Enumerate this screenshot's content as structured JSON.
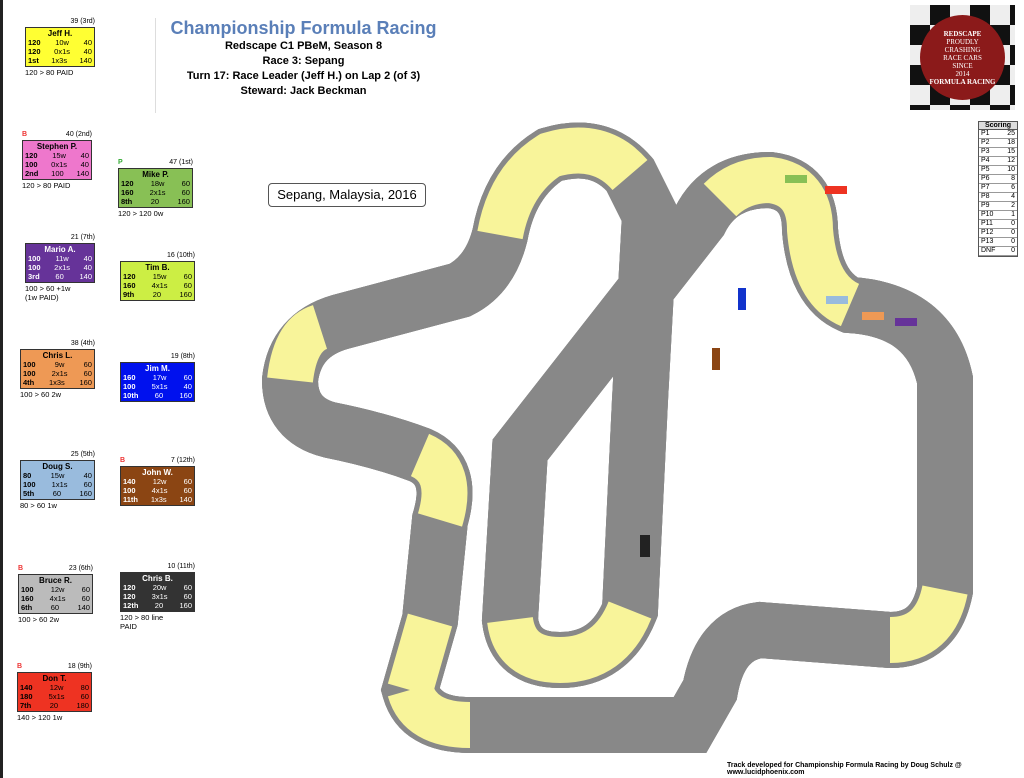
{
  "header": {
    "title": "Championship Formula Racing",
    "lines": [
      "Redscape C1 PBeM, Season 8",
      "Race 3: Sepang",
      "Turn 17: Race Leader (Jeff H.) on Lap 2 (of 3)",
      "Steward: Jack Beckman"
    ]
  },
  "location": "Sepang, Malaysia, 2016",
  "logo": {
    "text": "REDSCAPE FORMULA RACING PROUDLY CRASHING RACE CARS SINCE 2014"
  },
  "credit": "Track developed for Championship Formula Racing by Doug Schulz @ www.lucidphoenix.com",
  "scoring": {
    "title": "Scoring",
    "rows": [
      [
        "P1",
        "25"
      ],
      [
        "P2",
        "18"
      ],
      [
        "P3",
        "15"
      ],
      [
        "P4",
        "12"
      ],
      [
        "P5",
        "10"
      ],
      [
        "P6",
        "8"
      ],
      [
        "P7",
        "6"
      ],
      [
        "P8",
        "4"
      ],
      [
        "P9",
        "2"
      ],
      [
        "P10",
        "1"
      ],
      [
        "P11",
        "0"
      ],
      [
        "P12",
        "0"
      ],
      [
        "P13",
        "0"
      ],
      [
        "DNF",
        "0"
      ]
    ]
  },
  "drivers": [
    {
      "name": "Jeff H.",
      "pts": "39 (3rd)",
      "flag": "",
      "color": "#ffff33",
      "fg": "#000",
      "rows": [
        [
          "120",
          "10w",
          "40"
        ],
        [
          "120",
          "0x1s",
          "40"
        ],
        [
          "1st",
          "1x3s",
          "140"
        ]
      ],
      "note": "120 > 80 PAID"
    },
    {
      "name": "Stephen P.",
      "pts": "40 (2nd)",
      "flag": "B",
      "color": "#ee77cc",
      "fg": "#000",
      "rows": [
        [
          "120",
          "15w",
          "40"
        ],
        [
          "100",
          "0x1s",
          "40"
        ],
        [
          "2nd",
          "100",
          "140"
        ]
      ],
      "note": "120 > 80 PAID"
    },
    {
      "name": "Mike P.",
      "pts": "47 (1st)",
      "flag": "P",
      "color": "#88c055",
      "fg": "#000",
      "rows": [
        [
          "120",
          "18w",
          "60"
        ],
        [
          "160",
          "2x1s",
          "60"
        ],
        [
          "8th",
          "20",
          "160"
        ]
      ],
      "note": "120 > 120 0w"
    },
    {
      "name": "Mario A.",
      "pts": "21 (7th)",
      "flag": "",
      "color": "#663399",
      "fg": "#fff",
      "rows": [
        [
          "100",
          "11w",
          "40"
        ],
        [
          "100",
          "2x1s",
          "40"
        ],
        [
          "3rd",
          "60",
          "140"
        ]
      ],
      "note": "100 > 60 +1w\n(1w PAID)"
    },
    {
      "name": "Tim B.",
      "pts": "16 (10th)",
      "flag": "",
      "color": "#ccee44",
      "fg": "#000",
      "rows": [
        [
          "120",
          "15w",
          "60"
        ],
        [
          "160",
          "4x1s",
          "60"
        ],
        [
          "9th",
          "20",
          "160"
        ]
      ],
      "note": ""
    },
    {
      "name": "Chris L.",
      "pts": "38 (4th)",
      "flag": "",
      "color": "#ee9955",
      "fg": "#000",
      "rows": [
        [
          "100",
          "9w",
          "60"
        ],
        [
          "100",
          "2x1s",
          "60"
        ],
        [
          "4th",
          "1x3s",
          "160"
        ]
      ],
      "note": "100 > 60 2w"
    },
    {
      "name": "Jim M.",
      "pts": "19 (8th)",
      "flag": "",
      "color": "#0011ee",
      "fg": "#fff",
      "rows": [
        [
          "160",
          "17w",
          "60"
        ],
        [
          "100",
          "5x1s",
          "40"
        ],
        [
          "10th",
          "60",
          "160"
        ]
      ],
      "note": ""
    },
    {
      "name": "Doug S.",
      "pts": "25 (5th)",
      "flag": "",
      "color": "#99bbdd",
      "fg": "#000",
      "rows": [
        [
          "80",
          "15w",
          "40"
        ],
        [
          "100",
          "1x1s",
          "60"
        ],
        [
          "5th",
          "60",
          "160"
        ]
      ],
      "note": "80 > 60 1w"
    },
    {
      "name": "John W.",
      "pts": "7 (12th)",
      "flag": "B",
      "color": "#8b4513",
      "fg": "#fff",
      "rows": [
        [
          "140",
          "12w",
          "60"
        ],
        [
          "100",
          "4x1s",
          "60"
        ],
        [
          "11th",
          "1x3s",
          "140"
        ]
      ],
      "note": ""
    },
    {
      "name": "Bruce R.",
      "pts": "23 (6th)",
      "flag": "B",
      "color": "#bbbbbb",
      "fg": "#000",
      "rows": [
        [
          "100",
          "12w",
          "60"
        ],
        [
          "160",
          "4x1s",
          "60"
        ],
        [
          "6th",
          "60",
          "140"
        ]
      ],
      "note": "100 > 60 2w"
    },
    {
      "name": "Chris B.",
      "pts": "10 (11th)",
      "flag": "",
      "color": "#333333",
      "fg": "#fff",
      "rows": [
        [
          "120",
          "20w",
          "60"
        ],
        [
          "120",
          "3x1s",
          "60"
        ],
        [
          "12th",
          "20",
          "160"
        ]
      ],
      "note": "120 > 80 line\nPAID"
    },
    {
      "name": "Don T.",
      "pts": "18 (9th)",
      "flag": "B",
      "color": "#ee3322",
      "fg": "#000",
      "rows": [
        [
          "140",
          "12w",
          "80"
        ],
        [
          "180",
          "5x1s",
          "60"
        ],
        [
          "7th",
          "20",
          "180"
        ]
      ],
      "note": "140 > 120 1w"
    }
  ]
}
